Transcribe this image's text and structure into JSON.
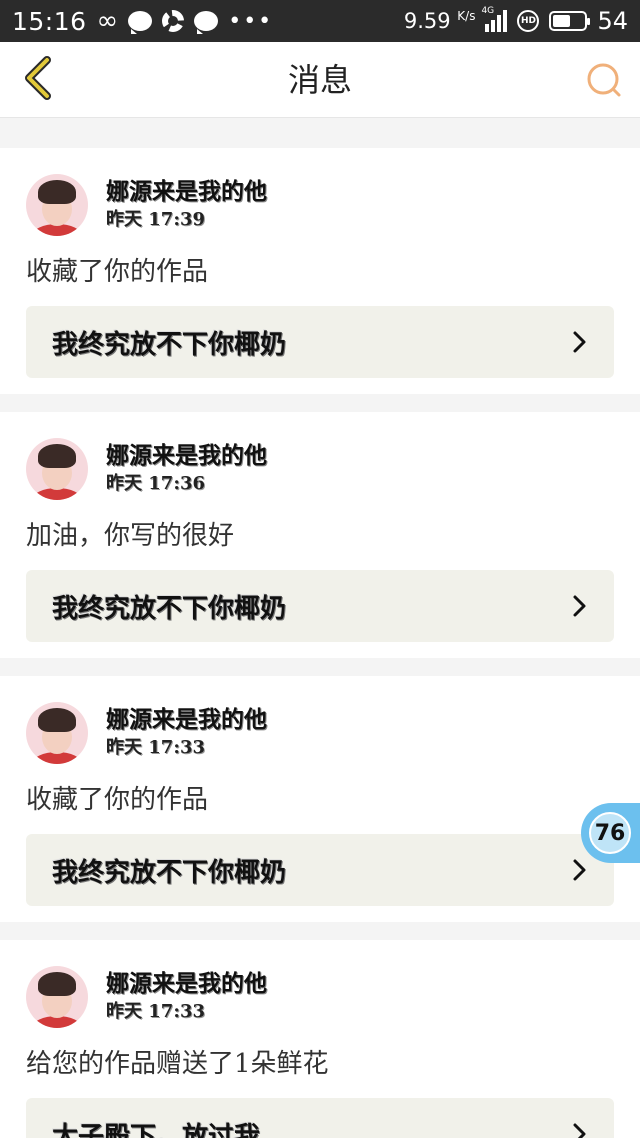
{
  "status_bar": {
    "time": "15:16",
    "net_speed": "9.59",
    "net_unit": "K/s",
    "net_tag": "4G",
    "hd": "HD",
    "battery": "54",
    "icons": [
      "infinity-icon",
      "chat-bubble-icon",
      "aperture-icon",
      "chat-bubble-icon",
      "more-dots-icon"
    ]
  },
  "header": {
    "title": "消息",
    "back_icon": "chevron-left-icon",
    "search_icon": "search-icon",
    "accent_color": "#f0b07a",
    "back_color": "#e2c93a"
  },
  "messages": [
    {
      "username": "娜源来是我的他",
      "time": "昨天  17:39",
      "action": "收藏了你的作品",
      "work_title": "我终究放不下你椰奶"
    },
    {
      "username": "娜源来是我的他",
      "time": "昨天  17:36",
      "action": "加油，你写的很好",
      "work_title": "我终究放不下你椰奶"
    },
    {
      "username": "娜源来是我的他",
      "time": "昨天  17:33",
      "action": "收藏了你的作品",
      "work_title": "我终究放不下你椰奶"
    },
    {
      "username": "娜源来是我的他",
      "time": "昨天  17:33",
      "action": "给您的作品赠送了1朵鲜花",
      "work_title": "太子殿下，放过我"
    }
  ],
  "floating_badge": {
    "count": "76",
    "color": "#6cc0ee"
  }
}
